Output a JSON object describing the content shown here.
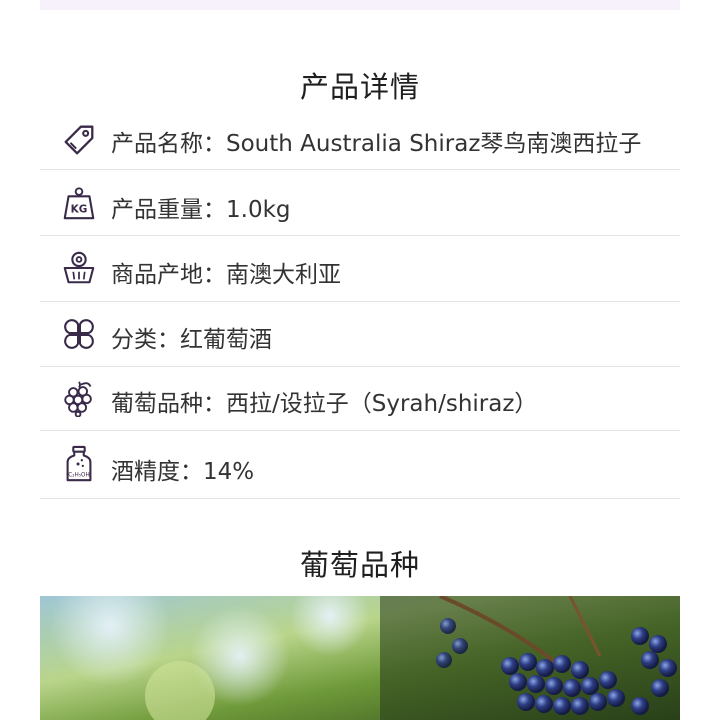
{
  "product_details": {
    "title": "产品详情",
    "rows": [
      {
        "icon": "tag-icon",
        "text": "产品名称：South Australia Shiraz琴鸟南澳西拉子"
      },
      {
        "icon": "kg-weight-icon",
        "text": "产品重量：1.0kg"
      },
      {
        "icon": "location-basket-icon",
        "text": "商品产地：南澳大利亚"
      },
      {
        "icon": "clover-icon",
        "text": "分类：红葡萄酒"
      },
      {
        "icon": "grape-icon",
        "text": "葡萄品种：西拉/设拉子（Syrah/shiraz）"
      },
      {
        "icon": "alcohol-bottle-icon",
        "text": "酒精度：14%"
      }
    ]
  },
  "grape_variety": {
    "title": "葡萄品种"
  },
  "colors": {
    "icon_stroke": "#3a2a4a",
    "divider": "#e4e4e4",
    "top_band": "#f6f1fb"
  }
}
